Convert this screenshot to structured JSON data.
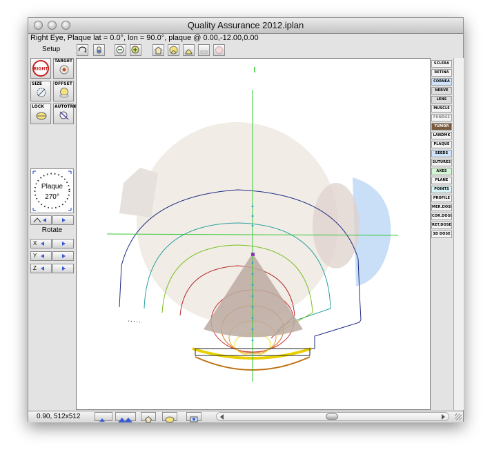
{
  "window": {
    "title": "Quality Assurance 2012.iplan",
    "status_line": "Right Eye, Plaque lat = 0.0°, lon = 90.0°, plaque @ 0.00,-12.00,0.00"
  },
  "toolbar": {
    "setup_label": "Setup",
    "buttons": [
      {
        "icon": "rotate-view-icon"
      },
      {
        "icon": "pan-hand-icon"
      },
      {
        "icon": "zoom-out-icon"
      },
      {
        "icon": "zoom-in-icon"
      },
      {
        "icon": "home-view-icon"
      },
      {
        "icon": "plaque-view-icon"
      },
      {
        "icon": "target-view-icon"
      },
      {
        "icon": "eraser-icon"
      },
      {
        "icon": "reset-icon"
      }
    ]
  },
  "left_panel": {
    "buttons": [
      {
        "label": "",
        "icon": "right-eye-icon",
        "icon_text": "RIGHT"
      },
      {
        "label": "TARGET",
        "icon": "target-icon"
      },
      {
        "label": "SIZE",
        "icon": "size-icon"
      },
      {
        "label": "OFFSET",
        "icon": "offset-icon"
      },
      {
        "label": "LOCK",
        "icon": "lock-icon"
      },
      {
        "label": "AUTOTRK",
        "icon": "autotrack-icon"
      }
    ],
    "plaque_dial": {
      "label": "Plaque",
      "value": "270°"
    },
    "rotate_label": "Rotate",
    "rotate_rows": [
      {
        "axis": "X"
      },
      {
        "axis": "Y"
      },
      {
        "axis": "Z"
      }
    ]
  },
  "right_panel": {
    "layers": [
      {
        "label": "SCLERA",
        "color": "#f4f4f4"
      },
      {
        "label": "RETINA",
        "color": "#f4f4f4"
      },
      {
        "label": "CORNEA",
        "color": "#cfe4fb"
      },
      {
        "label": "NERVE",
        "color": "#dcdcdc"
      },
      {
        "label": "LENS",
        "color": "#dcdcdc"
      },
      {
        "label": "MUSCLE",
        "color": "#f4f4f4"
      },
      {
        "label": "FUNDUS",
        "color": "#f4f4f4"
      },
      {
        "label": "TUMOR",
        "color": "#7a5a3e"
      },
      {
        "label": "LANDMK",
        "color": "#f4f4f4"
      },
      {
        "label": "PLAQUE",
        "color": "#f4f4f4"
      },
      {
        "label": "SEEDS",
        "color": "#cfe4fb"
      },
      {
        "label": "SUTURES",
        "color": "#f4f4f4"
      },
      {
        "label": "AXES",
        "color": "#d6f5d6"
      },
      {
        "label": "PLANE",
        "color": "#f4f4f4"
      },
      {
        "label": "POINTS",
        "color": "#d8f4f6"
      },
      {
        "label": "PROFILE",
        "color": "#f4f4f4"
      },
      {
        "label": "MER.DOSE",
        "color": "#f4f4f4"
      },
      {
        "label": "COR.DOSE",
        "color": "#f4f4f4"
      },
      {
        "label": "RET.DOSE",
        "color": "#f4f4f4"
      },
      {
        "label": "3D DOSE",
        "color": "#f4f4f4"
      }
    ]
  },
  "bottom_bar": {
    "zoom_text": "0.90, 512x512",
    "buttons": [
      {
        "icon": "mountain-small-icon"
      },
      {
        "icon": "mountain-large-icon"
      },
      {
        "icon": "home-icon"
      },
      {
        "icon": "plaque-icon"
      },
      {
        "icon": "camera-icon"
      }
    ]
  },
  "colors": {
    "sclera": "#f1ece6",
    "cornea": "#c9dff8",
    "tumor": "#bcaaa0",
    "axis": "#32c832",
    "seeds": "#2aa7c8"
  }
}
